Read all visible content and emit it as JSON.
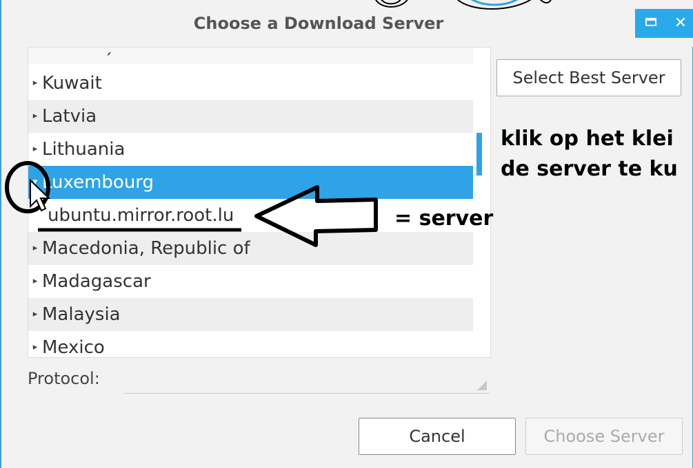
{
  "window": {
    "title": "Choose a Download Server",
    "accent_color": "#29a9ea",
    "maximize_icon": "maximize-icon",
    "close_icon": "close-icon",
    "close_glyph": "✕"
  },
  "server_list": {
    "partial_top": "",
    "rows": [
      {
        "label": "Kuwait",
        "expander": "▸",
        "state": "collapsed"
      },
      {
        "label": "Latvia",
        "expander": "▸",
        "state": "collapsed"
      },
      {
        "label": "Lithuania",
        "expander": "▸",
        "state": "collapsed"
      },
      {
        "label": "Luxembourg",
        "expander": "▾",
        "state": "expanded-selected"
      },
      {
        "label": "ubuntu.mirror.root.lu",
        "expander": "",
        "state": "child"
      },
      {
        "label": "Macedonia, Republic of",
        "expander": "▸",
        "state": "collapsed"
      },
      {
        "label": "Madagascar",
        "expander": "▸",
        "state": "collapsed"
      },
      {
        "label": "Malaysia",
        "expander": "▸",
        "state": "collapsed"
      },
      {
        "label": "Mexico",
        "expander": "▸",
        "state": "collapsed"
      }
    ],
    "selection_color": "#2ea3e8"
  },
  "protocol": {
    "label": "Protocol:",
    "value": ""
  },
  "buttons": {
    "select_best": "Select Best Server",
    "cancel": "Cancel",
    "choose": "Choose Server"
  },
  "annotations": {
    "line1": "klik op het klei",
    "line2": "de server te ku",
    "arrow_label": "= server"
  }
}
